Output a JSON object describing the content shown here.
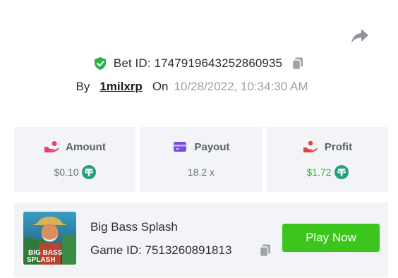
{
  "bet": {
    "id_label": "Bet ID:",
    "id_value": "1747919643252860935",
    "by_label": "By",
    "username": "1milxrp",
    "on_label": "On",
    "datetime": "10/28/2022, 10:34:30 AM"
  },
  "stats": {
    "amount": {
      "label": "Amount",
      "value": "$0.10",
      "icon": "hand-coins-icon",
      "color": "#e8436b"
    },
    "payout": {
      "label": "Payout",
      "value": "18.2 x",
      "icon": "card-icon",
      "color": "#7b4de8"
    },
    "profit": {
      "label": "Profit",
      "value": "$1.72",
      "icon": "hand-give-icon",
      "color": "#e2453c"
    }
  },
  "game": {
    "name": "Big Bass Splash",
    "id_label": "Game ID:",
    "id_value": "7513260891813",
    "thumb_text_1": "BIG BASS",
    "thumb_text_2": "SPLASH",
    "play_label": "Play Now"
  },
  "colors": {
    "accent_green": "#3cc51c",
    "profit_green": "#2bbf2b",
    "tether": "#26a17b",
    "card_bg": "#f3f4f7"
  }
}
